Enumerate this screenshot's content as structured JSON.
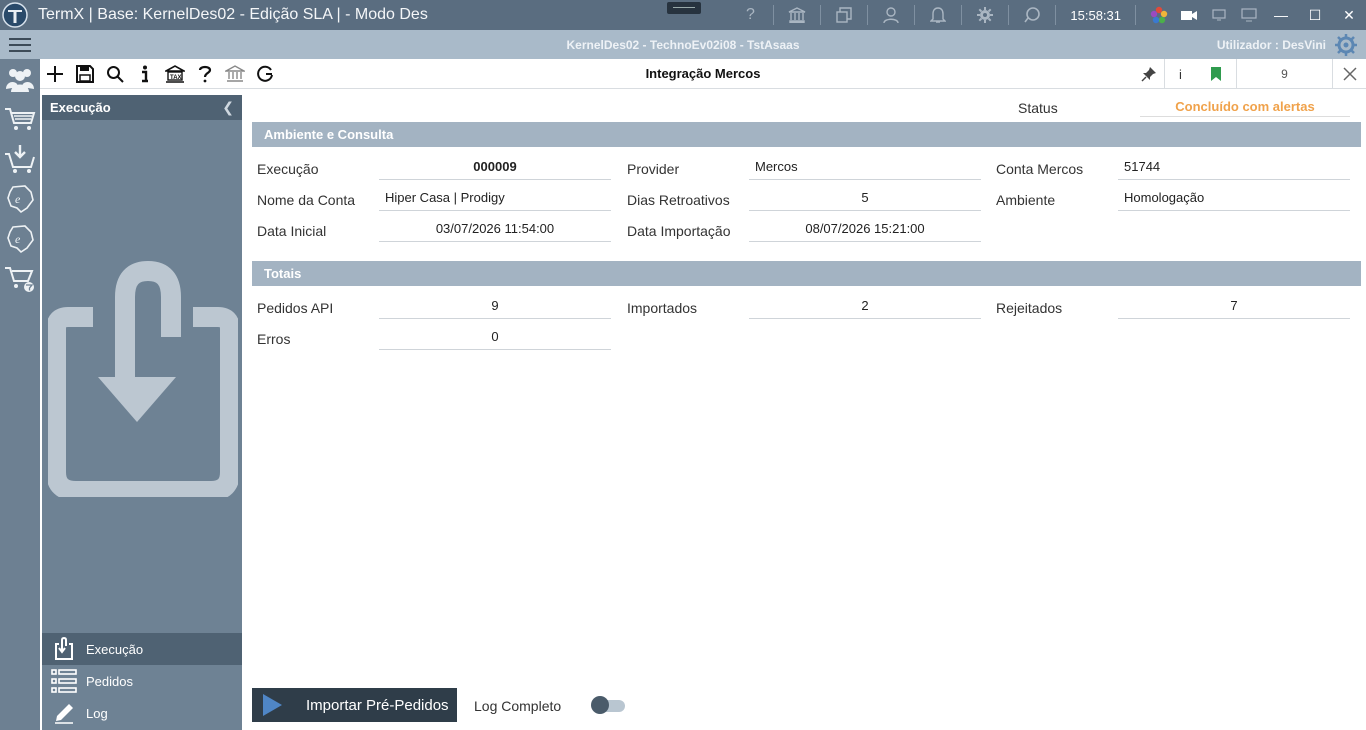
{
  "window": {
    "title": "TermX | Base: KernelDes02 - Edição SLA | - Modo Des",
    "clock": "15:58:31"
  },
  "infobar": {
    "center": "KernelDes02 - TechnoEv02i08 - TstAsaas",
    "user": "Utilizador :  DesVini"
  },
  "toolbar": {
    "title": "Integração Mercos",
    "info": "i",
    "counter": "9"
  },
  "panel": {
    "header": "Execução",
    "nav": [
      {
        "label": "Execução",
        "icon": "execution-icon"
      },
      {
        "label": "Pedidos",
        "icon": "list-icon"
      },
      {
        "label": "Log",
        "icon": "pencil-icon"
      }
    ]
  },
  "status": {
    "label": "Status",
    "value": "Concluído com alertas",
    "color": "#f0a24b"
  },
  "sections": {
    "ambiente": "Ambiente e Consulta",
    "totais": "Totais"
  },
  "fields": {
    "execucao": {
      "label": "Execução",
      "value": "000009"
    },
    "provider": {
      "label": "Provider",
      "value": "Mercos"
    },
    "conta_mercos": {
      "label": "Conta Mercos",
      "value": "51744"
    },
    "nome_conta": {
      "label": "Nome da Conta",
      "value": "Hiper Casa | Prodigy"
    },
    "dias_retroativos": {
      "label": "Dias Retroativos",
      "value": "5"
    },
    "ambiente": {
      "label": "Ambiente",
      "value": "Homologação"
    },
    "data_inicial": {
      "label": "Data Inicial",
      "value": "03/07/2026 11:54:00"
    },
    "data_importacao": {
      "label": "Data Importação",
      "value": "08/07/2026 15:21:00"
    }
  },
  "totais": {
    "pedidos_api": {
      "label": "Pedidos API",
      "value": "9"
    },
    "importados": {
      "label": "Importados",
      "value": "2"
    },
    "rejeitados": {
      "label": "Rejeitados",
      "value": "7"
    },
    "erros": {
      "label": "Erros",
      "value": "0"
    }
  },
  "actions": {
    "import_button": "Importar Pré-Pedidos",
    "log_completo": "Log Completo",
    "log_completo_on": false
  },
  "colors": {
    "titlebar": "#5a6d80",
    "infobar": "#a9bac9",
    "panel": "#6e8294",
    "section": "#a3b3c2"
  }
}
